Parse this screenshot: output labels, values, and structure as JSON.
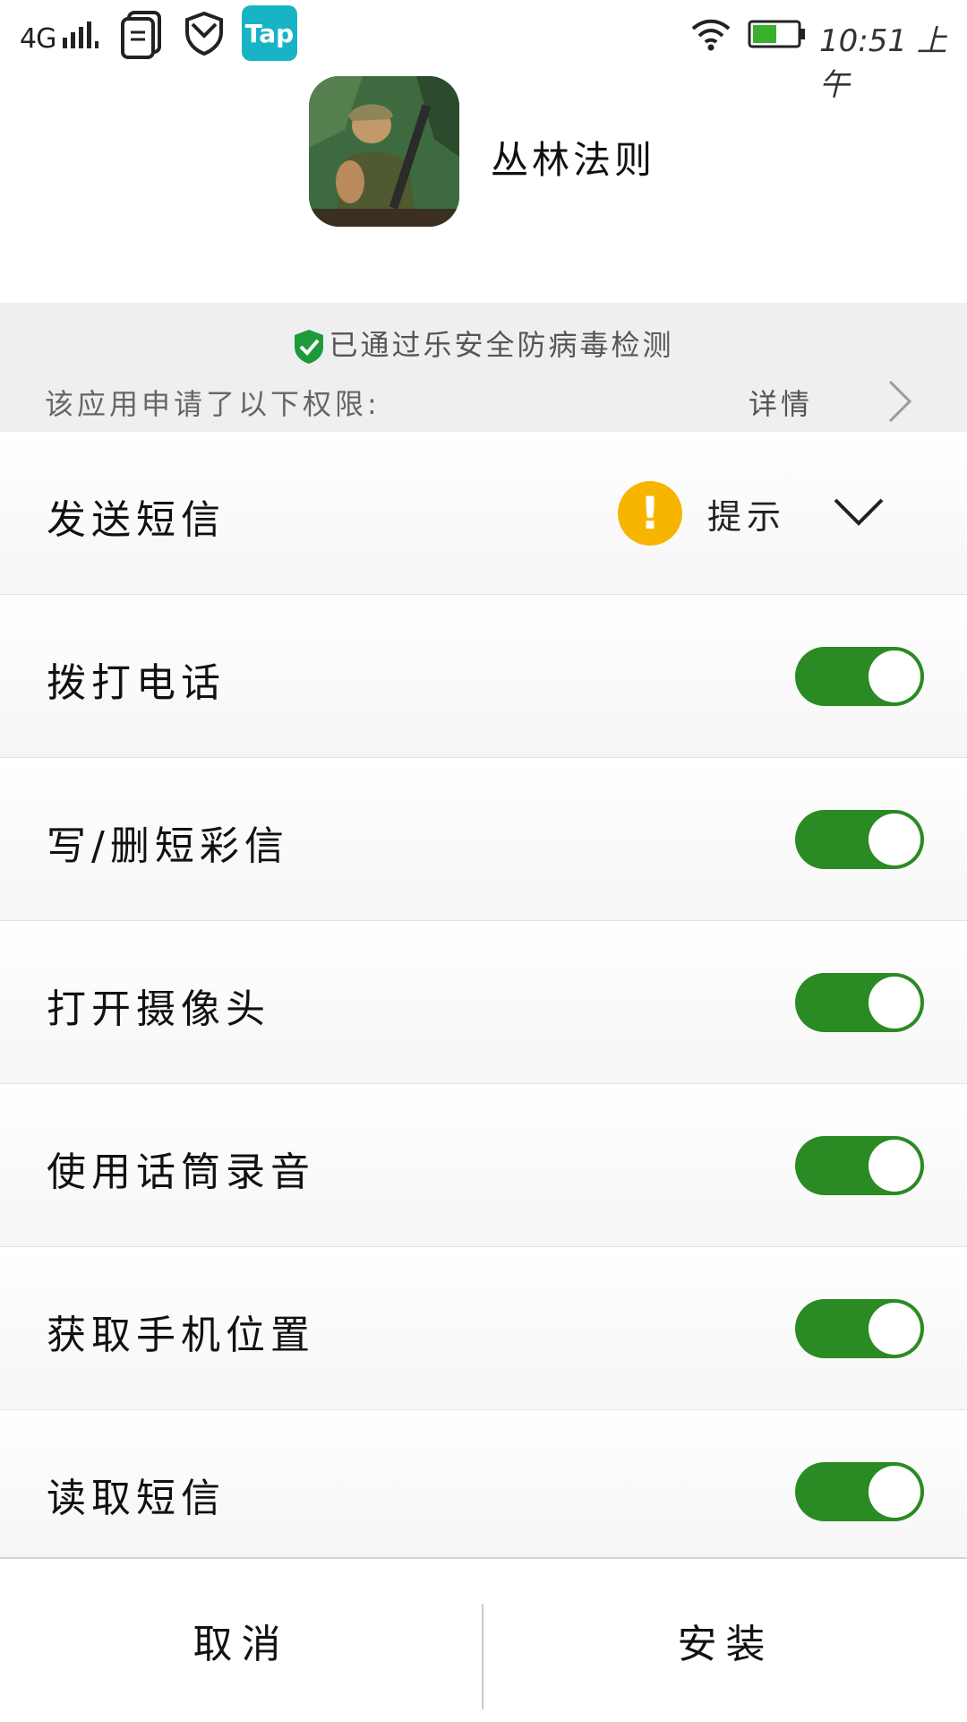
{
  "status_bar": {
    "network": "4G",
    "time": "10:51 上午",
    "tap_label": "Tap",
    "battery_color": "#3ab02e"
  },
  "app": {
    "name": "丛林法则"
  },
  "security": {
    "scan_text": "已通过乐安全防病毒检测",
    "permissions_intro": "该应用申请了以下权限:",
    "details_label": "详情"
  },
  "permissions": [
    {
      "label": "发送短信",
      "mode": "prompt",
      "status_text": "提示",
      "icon": "warning-icon"
    },
    {
      "label": "拨打电话",
      "enabled": true
    },
    {
      "label": "写/删短彩信",
      "enabled": true
    },
    {
      "label": "打开摄像头",
      "enabled": true
    },
    {
      "label": "使用话筒录音",
      "enabled": true
    },
    {
      "label": "获取手机位置",
      "enabled": true
    },
    {
      "label": "读取短信",
      "enabled": true
    }
  ],
  "actions": {
    "cancel_label": "取消",
    "install_label": "安装"
  },
  "colors": {
    "toggle_on": "#2a8a23",
    "warning": "#f7b500",
    "tap_brand": "#18b4c6"
  }
}
